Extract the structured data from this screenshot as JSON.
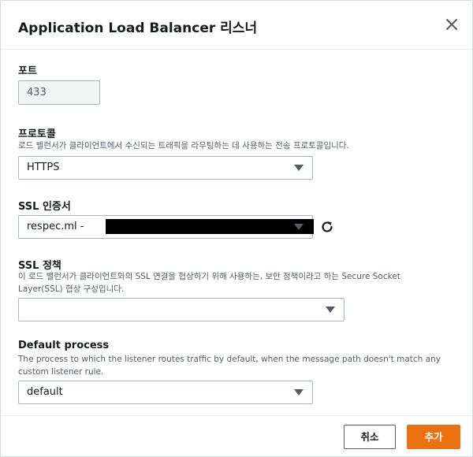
{
  "dialog": {
    "title": "Application Load Balancer 리스너",
    "close_icon": "close-icon"
  },
  "port": {
    "label": "포트",
    "value": "433"
  },
  "protocol": {
    "label": "프로토콜",
    "description": "로드 밸런서가 클라이언트에서 수신되는 트래픽을 라우팅하는 데 사용하는 전송 프로토콜입니다.",
    "value": "HTTPS"
  },
  "ssl_certificate": {
    "label": "SSL 인증서",
    "value": "respec.ml -",
    "refresh_icon": "refresh-icon"
  },
  "ssl_policy": {
    "label": "SSL 정책",
    "description": "이 로드 밸런서가 클라이언트와의 SSL 연결을 협상하기 위해 사용하는, 보안 정책이라고 하는 Secure Socket Layer(SSL) 협상 구성입니다.",
    "value": ""
  },
  "default_process": {
    "label": "Default process",
    "description": "The process to which the listener routes traffic by default, when the message path doesn't match any custom listener rule.",
    "value": "default"
  },
  "footer": {
    "cancel_label": "취소",
    "add_label": "추가"
  },
  "colors": {
    "primary": "#ec7211",
    "text": "#16191f",
    "muted": "#545b64",
    "border": "#aab7b8"
  }
}
